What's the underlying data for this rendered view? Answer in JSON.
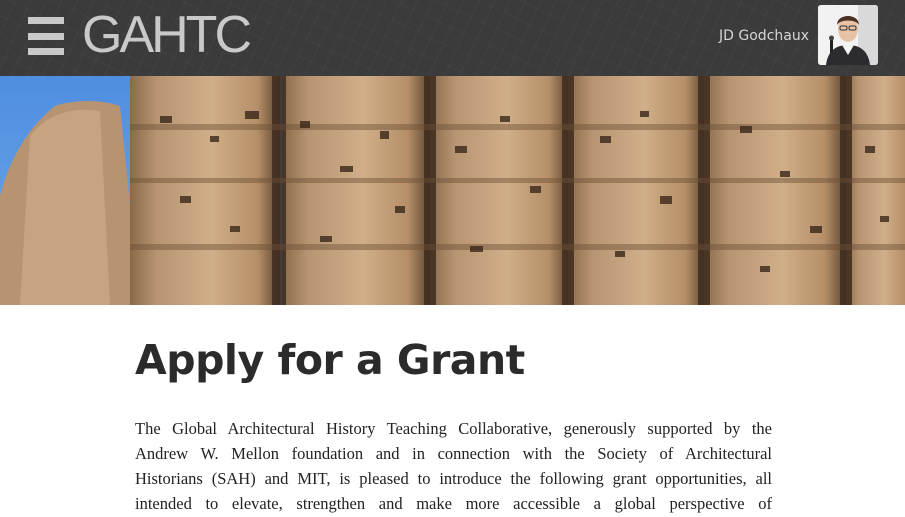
{
  "header": {
    "logo_text": "GAHTC",
    "user_name": "JD Godchaux"
  },
  "hero": {
    "sky_color": "#5d9be0",
    "wall_color": "#c29f77"
  },
  "main": {
    "title": "Apply for a Grant",
    "intro_lines": [
      "The Global Architectural History Teaching Collaborative, generously supported by the",
      "Andrew W. Mellon foundation and in connection with the Society of Architectural",
      "Historians (SAH) and MIT, is pleased to introduce the following grant opportunities, all",
      "intended to elevate, strengthen and make more accessible a global perspective of"
    ]
  },
  "colors": {
    "topbar": "#3b3b3b",
    "logo": "#c9c9c9",
    "title": "#2b2b2b"
  }
}
